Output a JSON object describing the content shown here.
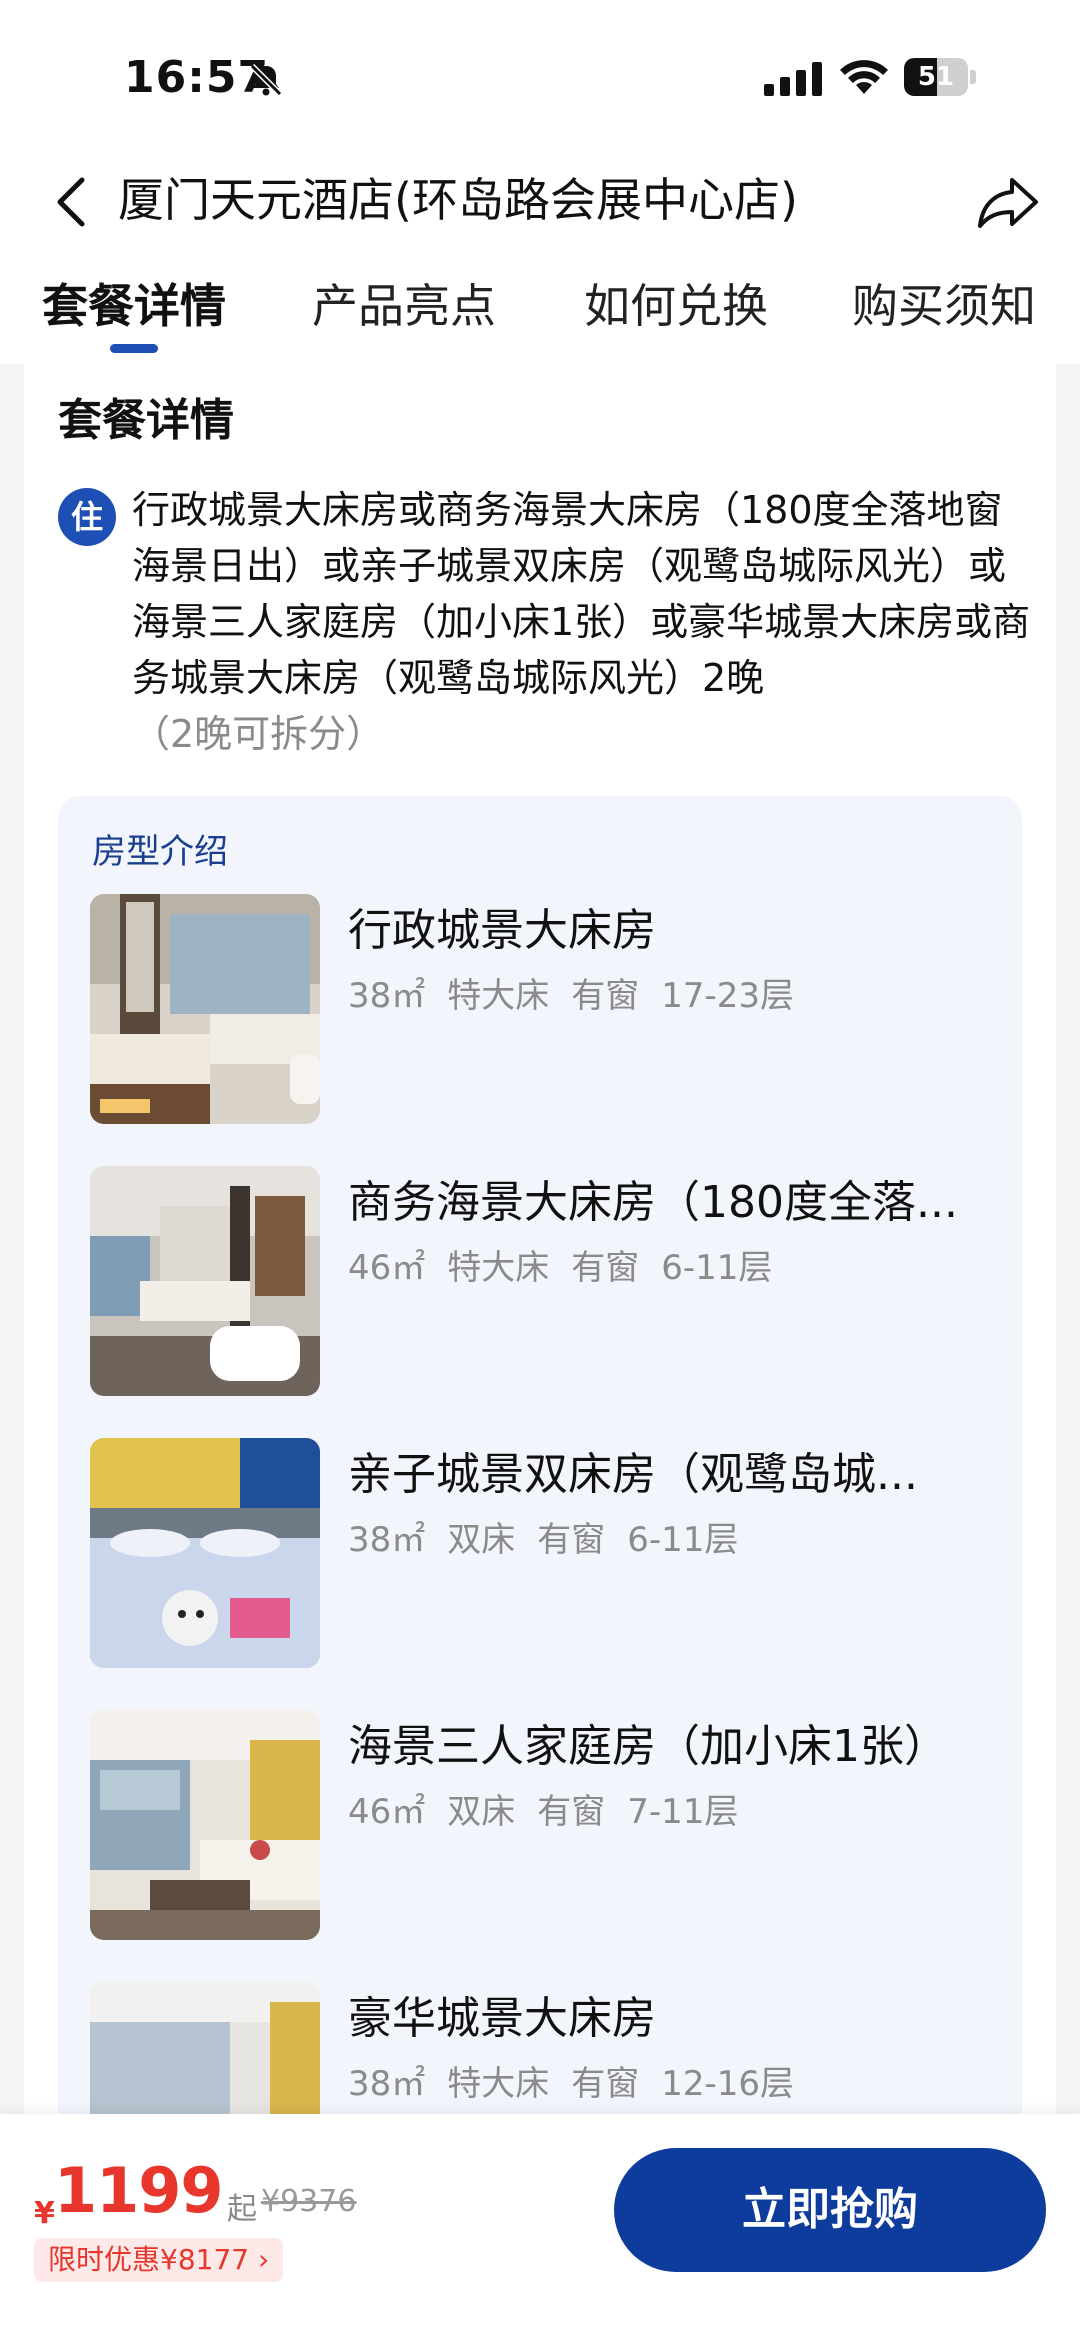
{
  "status_bar": {
    "time": "16:57",
    "battery": "51",
    "battery_level_percent": 51,
    "icons": [
      "bell-muted-icon",
      "signal-icon",
      "wifi-icon",
      "battery-icon"
    ]
  },
  "header": {
    "title": "厦门天元酒店(环岛路会展中心店)",
    "back_icon": "chevron-left-icon",
    "share_icon": "share-icon"
  },
  "tabs": [
    {
      "label": "套餐详情",
      "active": true
    },
    {
      "label": "产品亮点",
      "active": false
    },
    {
      "label": "如何兑换",
      "active": false
    },
    {
      "label": "购买须知",
      "active": false
    }
  ],
  "package": {
    "section_title": "套餐详情",
    "stay_badge": "住",
    "description": "行政城景大床房或商务海景大床房（180度全落地窗海景日出）或亲子城景双床房（观鹭岛城际风光）或海景三人家庭房（加小床1张）或豪华城景大床房或商务城景大床房（观鹭岛城际风光）2晚",
    "note": "（2晚可拆分）"
  },
  "room_panel": {
    "title": "房型介绍",
    "rooms": [
      {
        "name": "行政城景大床房",
        "area": "38㎡",
        "bed": "特大床",
        "window": "有窗",
        "floor": "17-23层"
      },
      {
        "name": "商务海景大床房（180度全落...",
        "area": "46㎡",
        "bed": "特大床",
        "window": "有窗",
        "floor": "6-11层"
      },
      {
        "name": "亲子城景双床房（观鹭岛城...",
        "area": "38㎡",
        "bed": "双床",
        "window": "有窗",
        "floor": "6-11层"
      },
      {
        "name": "海景三人家庭房（加小床1张）",
        "area": "46㎡",
        "bed": "双床",
        "window": "有窗",
        "floor": "7-11层"
      },
      {
        "name": "豪华城景大床房",
        "area": "38㎡",
        "bed": "特大床",
        "window": "有窗",
        "floor": "12-16层"
      }
    ]
  },
  "bottom_bar": {
    "currency": "¥",
    "price": "1199",
    "price_suffix": "起",
    "original_price": "¥9376",
    "discount_label": "限时优惠¥8177 ›",
    "buy_label": "立即抢购"
  },
  "colors": {
    "accent_blue": "#1e4fb4",
    "button_blue": "#0d3c9c",
    "price_red": "#e8362d",
    "panel_bg": "#f2f5fb"
  }
}
